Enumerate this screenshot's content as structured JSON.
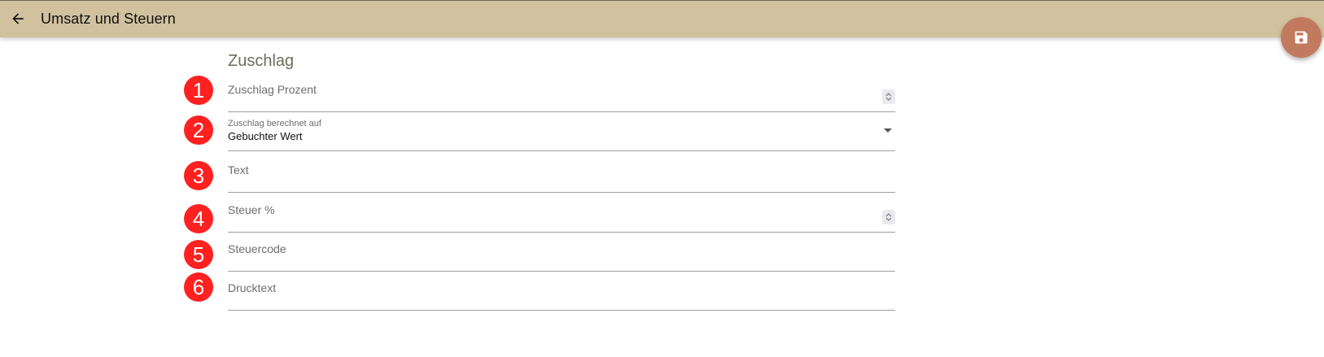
{
  "appbar": {
    "title": "Umsatz und Steuern",
    "back_icon": "arrow-left-icon",
    "background": "#d1c19f"
  },
  "fab": {
    "icon": "save-icon",
    "color": "#c27a5f"
  },
  "section": {
    "title": "Zuschlag"
  },
  "badges": [
    "1",
    "2",
    "3",
    "4",
    "5",
    "6"
  ],
  "fields": {
    "zuschlag_prozent": {
      "label": "Zuschlag Prozent",
      "type": "number",
      "value": ""
    },
    "zuschlag_berechnet_auf": {
      "label": "Zuschlag berechnet auf",
      "type": "select",
      "value": "Gebuchter Wert"
    },
    "text": {
      "label": "Text",
      "type": "text",
      "value": ""
    },
    "steuer": {
      "label": "Steuer %",
      "type": "number",
      "value": ""
    },
    "steuercode": {
      "label": "Steuercode",
      "type": "text",
      "value": ""
    },
    "drucktext": {
      "label": "Drucktext",
      "type": "text",
      "value": ""
    }
  },
  "badge_color": "#ff2020"
}
